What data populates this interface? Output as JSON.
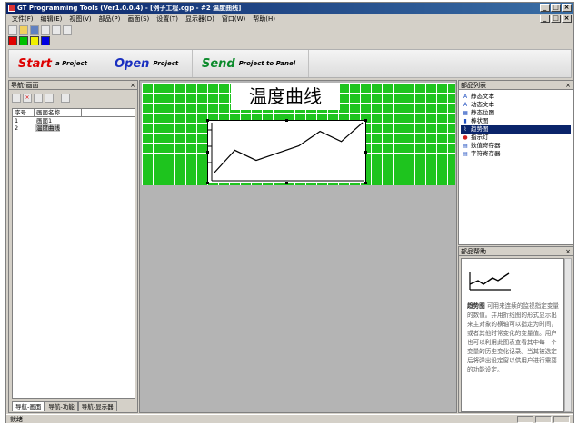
{
  "window": {
    "title": "GT Programming Tools (Ver1.0.0.4) - [例子工程.cgp - #2 温度曲线]"
  },
  "menu": [
    "文件(F)",
    "编辑(E)",
    "视图(V)",
    "部品(P)",
    "画面(S)",
    "设置(T)",
    "显示器(D)",
    "窗口(W)",
    "帮助(H)"
  ],
  "toolbar": {
    "colors": [
      "#e00000",
      "#00c000",
      "#f0f000",
      "#0000e0"
    ]
  },
  "actions": [
    {
      "word": "Start",
      "suffix": "a Project"
    },
    {
      "word": "Open",
      "suffix": "Project"
    },
    {
      "word": "Send",
      "suffix": "Project to Panel"
    }
  ],
  "left_panel": {
    "title": "导航-画面",
    "columns": [
      "序号",
      "画面名称"
    ],
    "rows": [
      {
        "no": "1",
        "name": "画面1"
      },
      {
        "no": "2",
        "name": "温度曲线"
      }
    ],
    "tabs": [
      "导航-画面",
      "导航-功能",
      "导航-显示器"
    ]
  },
  "screen": {
    "title": "温度曲线",
    "trend_points": [
      0,
      16,
      9,
      14,
      19,
      29,
      22,
      35
    ]
  },
  "parts_panel": {
    "title": "部品列表",
    "items": [
      "静态文本",
      "动态文本",
      "静态位图",
      "棒状图",
      "趋势图",
      "指示灯",
      "数值寄存器",
      "字符寄存器"
    ],
    "icons": [
      "text-icon",
      "dynamic-text-icon",
      "bitmap-icon",
      "bar-chart-icon",
      "trend-icon",
      "lamp-icon",
      "numeric-register-icon",
      "string-register-icon"
    ],
    "selected_index": 4
  },
  "help_panel": {
    "title": "部品帮助",
    "term": "趋势图",
    "text": "可用来连续的监视指定变量的数值。并用折线图的形式显示出来主对象的横轴可以指定为时间，或者其他时常变化的变量值。用户也可以利用此图表查看其中每一个变量的历史变化记录。当其被选定后将弹出设定窗以供用户进行需要的功能设定。"
  },
  "status": {
    "text": "就绪"
  }
}
